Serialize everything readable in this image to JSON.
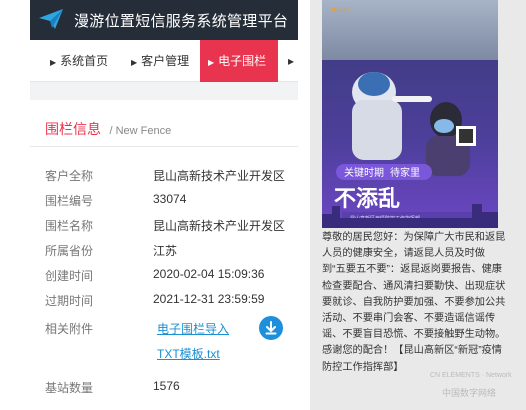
{
  "header": {
    "app_title": "漫游位置短信服务系统管理平台",
    "logo_icon": "paper-plane-icon"
  },
  "nav": {
    "items": [
      {
        "label": "系统首页",
        "active": false
      },
      {
        "label": "客户管理",
        "active": false
      },
      {
        "label": "电子围栏",
        "active": true
      }
    ],
    "overflow_arrow": "▸"
  },
  "section": {
    "title": "围栏信息",
    "subtitle": "/ New Fence"
  },
  "fields": {
    "customer_name": {
      "label": "客户全称",
      "value": "昆山高新技术产业开发区"
    },
    "fence_id": {
      "label": "围栏编号",
      "value": "33074"
    },
    "fence_name": {
      "label": "围栏名称",
      "value": "昆山高新技术产业开发区"
    },
    "province": {
      "label": "所属省份",
      "value": "江苏"
    },
    "created": {
      "label": "创建时间",
      "value": "2020-02-04 15:09:36"
    },
    "expires": {
      "label": "过期时间",
      "value": "2021-12-31 23:59:59"
    },
    "attachment": {
      "label": "相关附件",
      "link_line1": "电子围栏导入",
      "link_line2": "TXT模板.txt"
    },
    "stations": {
      "label": "基站数量",
      "value": "1576"
    }
  },
  "poster": {
    "brand": "KSHD",
    "slogan_top": "关键时期",
    "slogan_mid": "待家里",
    "slogan_big": "不添乱",
    "footer": "昆山高新区疫情防控工作指挥部",
    "body": "尊敬的居民您好：为保障广大市民和返昆人员的健康安全，请返昆人员及时做到“五要五不要”：返昆返岗要报告、健康检查要配合、通风清扫要勤快、出现症状要就诊、自我防护要加强、不要参加公共活动、不要串门会客、不要造谣信谣传谣、不要盲目恐慌、不要接触野生动物。感谢您的配合！【昆山高新区“新冠”疫情防控工作指挥部】"
  },
  "watermark": {
    "line1": "CN ELEMENTS · Network",
    "line2": "中国数字网络"
  },
  "colors": {
    "accent": "#e8344e",
    "topbar": "#252d39",
    "link": "#1a8fd1"
  }
}
